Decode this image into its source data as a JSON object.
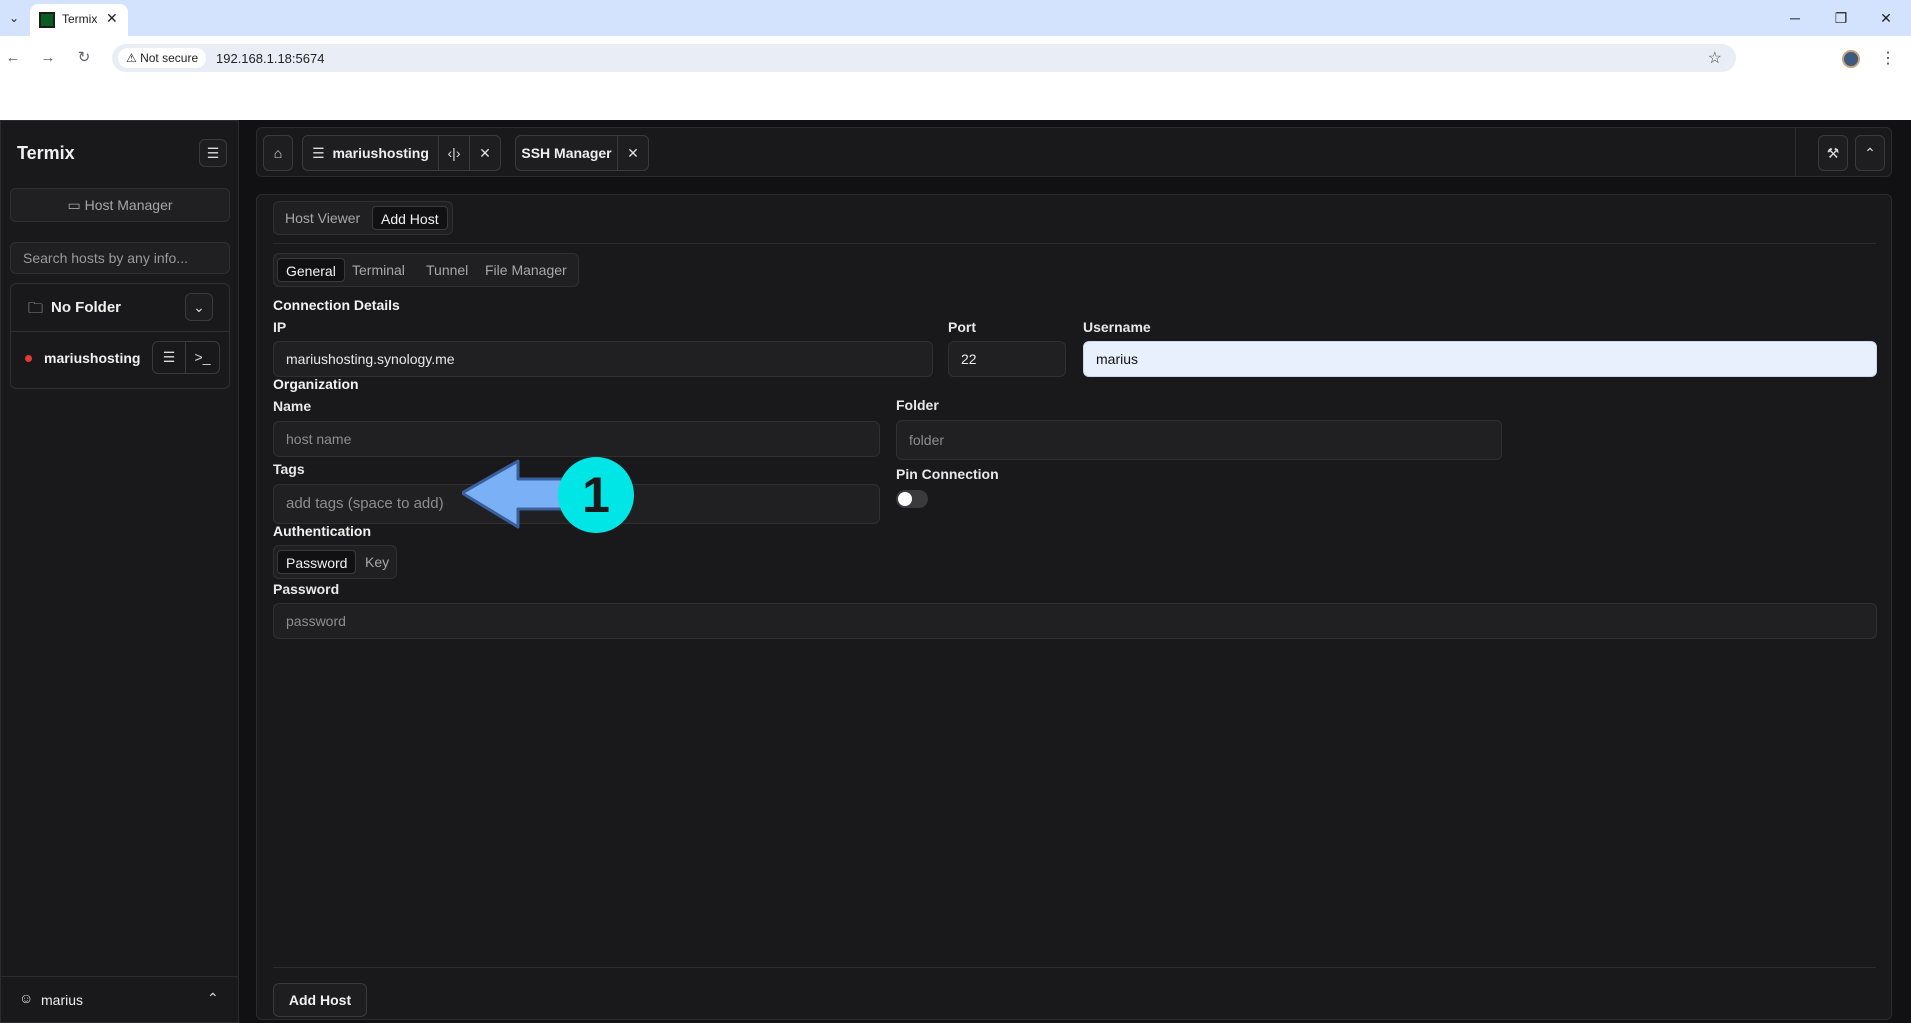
{
  "browser": {
    "tab_title": "Termix",
    "tab_close": "✕",
    "not_secure": "Not secure",
    "url": "192.168.1.18:5674"
  },
  "sidebar": {
    "brand": "Termix",
    "host_manager_label": "Host Manager",
    "search_placeholder": "Search hosts by any info...",
    "folder_name": "No Folder",
    "host_name": "mariushosting",
    "user_name": "marius"
  },
  "topbar": {
    "tabs": [
      {
        "label": "mariushosting"
      },
      {
        "label": "SSH Manager"
      }
    ]
  },
  "panel": {
    "mode_tabs": [
      "Host Viewer",
      "Add Host"
    ],
    "section_tabs": [
      "General",
      "Terminal",
      "Tunnel",
      "File Manager"
    ],
    "connection_details": "Connection Details",
    "ip_label": "IP",
    "ip_value": "mariushosting.synology.me",
    "port_label": "Port",
    "port_value": "22",
    "username_label": "Username",
    "username_value": "marius",
    "organization": "Organization",
    "name_label": "Name",
    "name_placeholder": "host name",
    "folder_label": "Folder",
    "folder_placeholder": "folder",
    "tags_label": "Tags",
    "tags_placeholder": "add tags (space to add)",
    "pin_label": "Pin Connection",
    "pin_on": false,
    "authentication": "Authentication",
    "auth_tabs": [
      "Password",
      "Key"
    ],
    "password_label": "Password",
    "password_placeholder": "password",
    "submit": "Add Host"
  },
  "annotation": {
    "number": "1",
    "arrow_color": "#7ab0f5",
    "circle_color": "#00e5e5"
  }
}
